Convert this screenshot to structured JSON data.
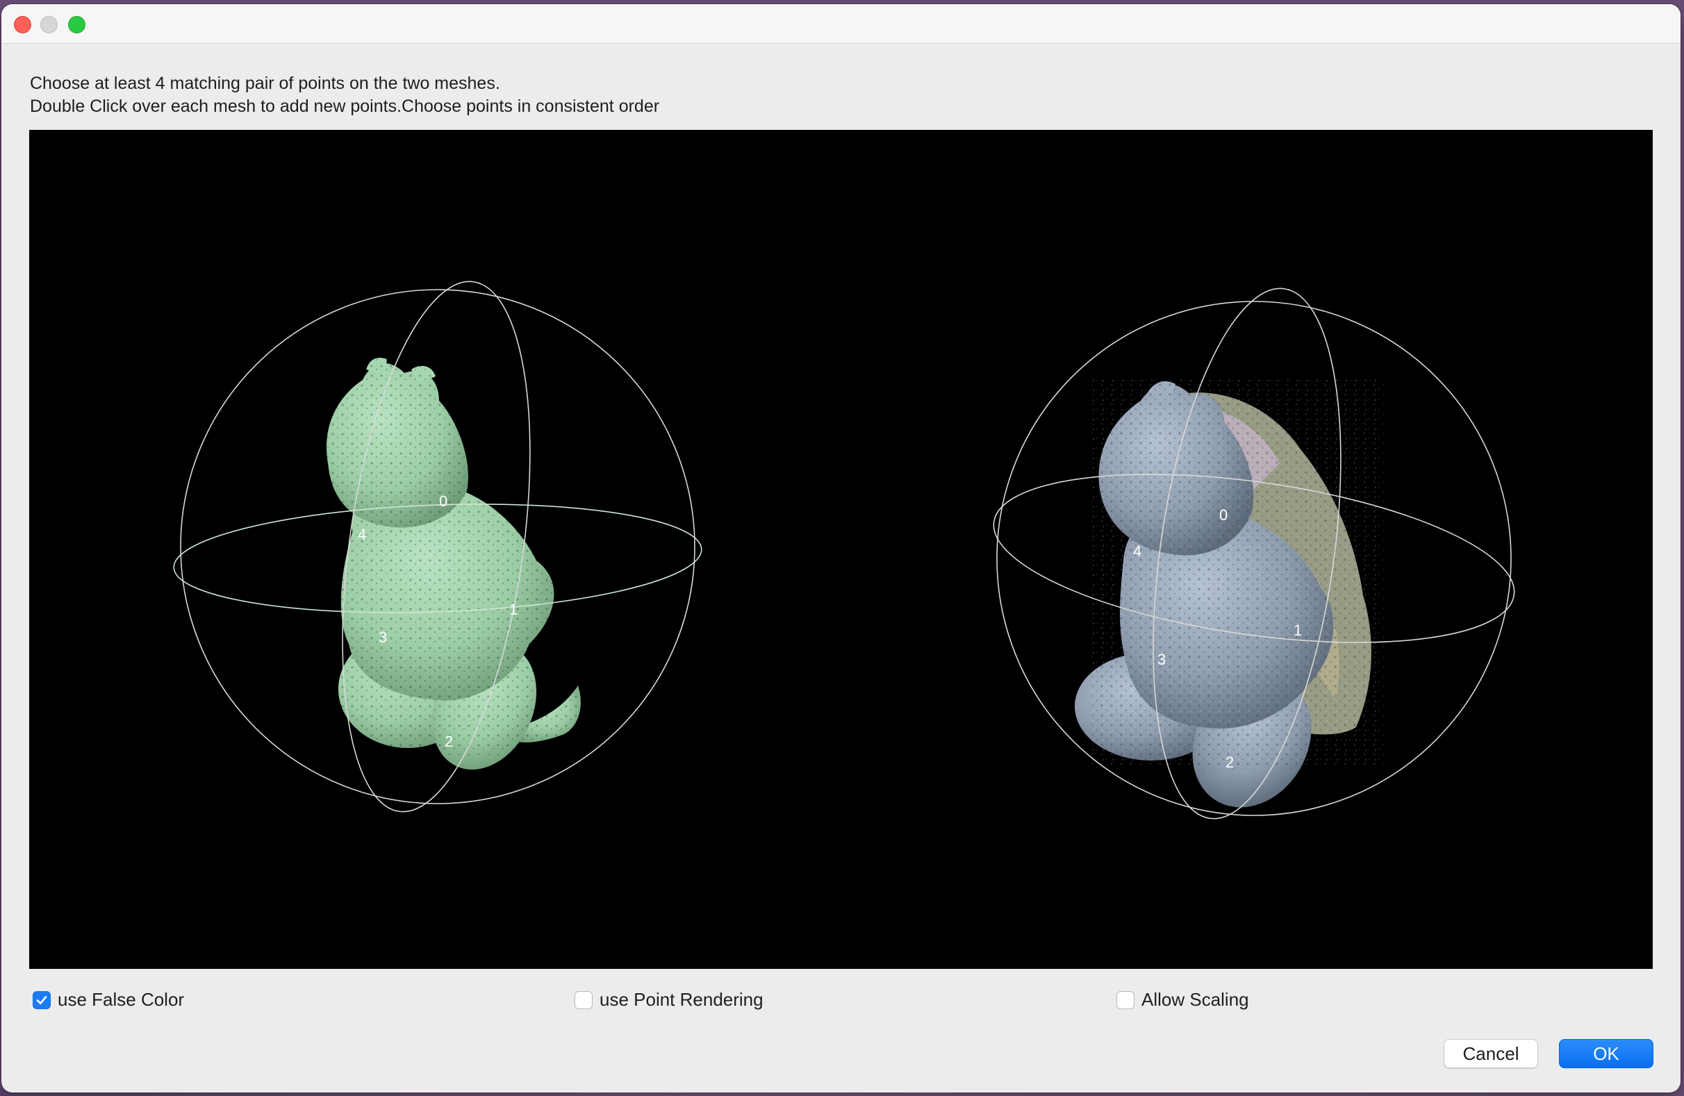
{
  "window": {
    "controls": [
      "close",
      "minimize",
      "zoom"
    ]
  },
  "instructions": {
    "line1": "Choose at least 4 matching pair of points on the two meshes.",
    "line2": "Double Click over each mesh to add new points.Choose points in consistent order"
  },
  "viewer": {
    "left_mesh": {
      "color": "#9ccea6",
      "point_labels": [
        "0",
        "1",
        "2",
        "3",
        "4"
      ]
    },
    "right_mesh": {
      "color": "#8e9cae",
      "point_labels": [
        "0",
        "1",
        "2",
        "3",
        "4"
      ]
    }
  },
  "options": {
    "false_color": {
      "label": "use False Color",
      "checked": true
    },
    "point_rendering": {
      "label": "use Point Rendering",
      "checked": false
    },
    "allow_scaling": {
      "label": "Allow Scaling",
      "checked": false
    }
  },
  "buttons": {
    "cancel": "Cancel",
    "ok": "OK"
  },
  "colors": {
    "accent": "#1a7cf4",
    "close": "#fe5f57",
    "zoom": "#29c941"
  }
}
